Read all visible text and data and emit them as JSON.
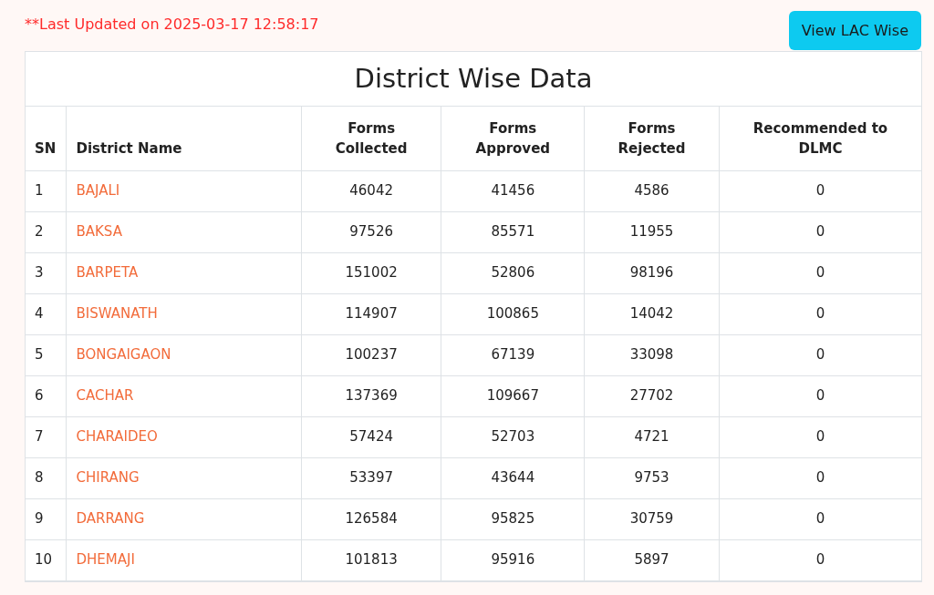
{
  "last_updated": "**Last Updated on 2025-03-17 12:58:17",
  "view_button": "View LAC Wise",
  "table": {
    "title": "District Wise Data",
    "columns": [
      "SN",
      "District Name",
      "Forms Collected",
      "Forms Approved",
      "Forms Rejected",
      "Recommended to DLMC"
    ],
    "rows": [
      [
        "1",
        "BAJALI",
        "46042",
        "41456",
        "4586",
        "0"
      ],
      [
        "2",
        "BAKSA",
        "97526",
        "85571",
        "11955",
        "0"
      ],
      [
        "3",
        "BARPETA",
        "151002",
        "52806",
        "98196",
        "0"
      ],
      [
        "4",
        "BISWANATH",
        "114907",
        "100865",
        "14042",
        "0"
      ],
      [
        "5",
        "BONGAIGAON",
        "100237",
        "67139",
        "33098",
        "0"
      ],
      [
        "6",
        "CACHAR",
        "137369",
        "109667",
        "27702",
        "0"
      ],
      [
        "7",
        "CHARAIDEO",
        "57424",
        "52703",
        "4721",
        "0"
      ],
      [
        "8",
        "CHIRANG",
        "53397",
        "43644",
        "9753",
        "0"
      ],
      [
        "9",
        "DARRANG",
        "126584",
        "95825",
        "30759",
        "0"
      ],
      [
        "10",
        "DHEMAJI",
        "101813",
        "95916",
        "5897",
        "0"
      ]
    ]
  }
}
